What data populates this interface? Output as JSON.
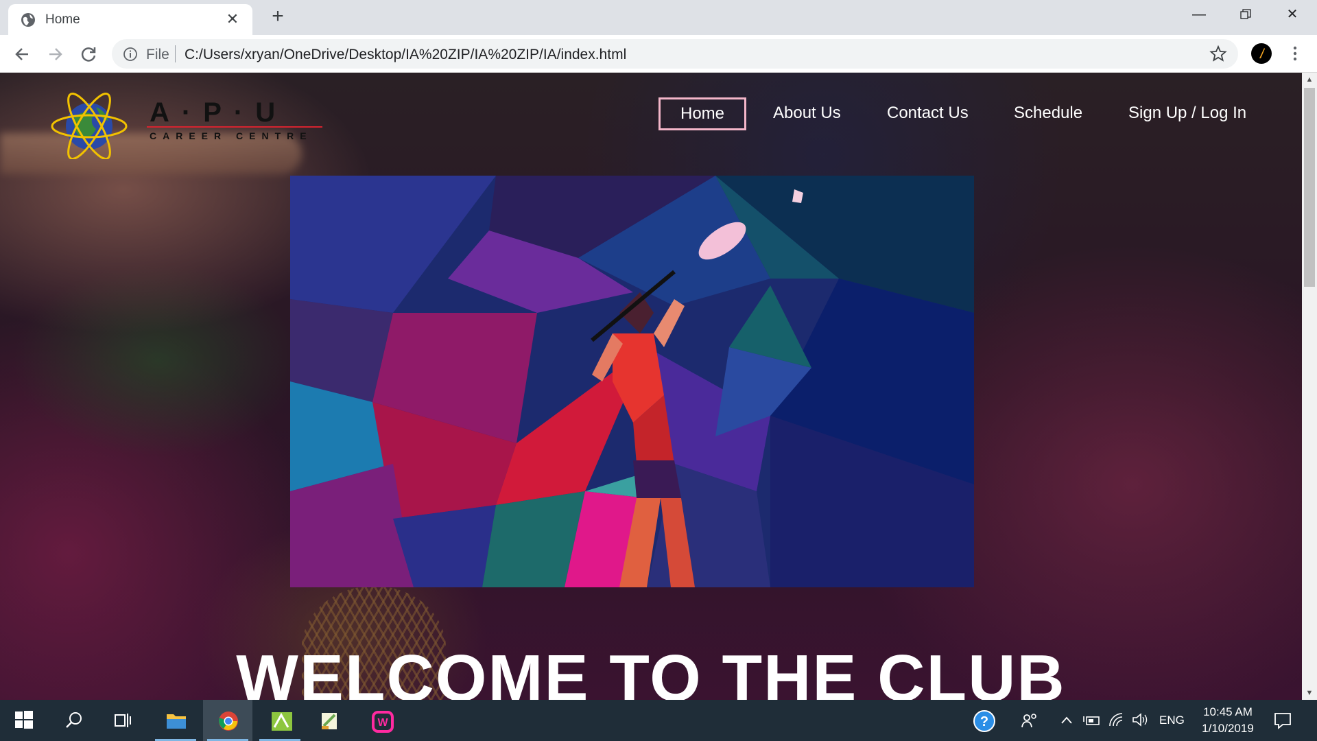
{
  "browser": {
    "tab": {
      "title": "Home",
      "favicon": "globe-icon"
    },
    "address": {
      "scheme": "File",
      "url": "C:/Users/xryan/OneDrive/Desktop/IA%20ZIP/IA%20ZIP/IA/index.html"
    },
    "icons": [
      "back-arrow-icon",
      "forward-arrow-icon",
      "reload-icon",
      "info-icon",
      "star-icon",
      "menu-dots-icon"
    ]
  },
  "site": {
    "logo": {
      "letters": "A·P·U",
      "subtitle": "CAREER CENTRE"
    },
    "nav": [
      {
        "label": "Home",
        "active": true
      },
      {
        "label": "About Us"
      },
      {
        "label": "Contact Us"
      },
      {
        "label": "Schedule"
      },
      {
        "label": "Sign Up / Log In"
      }
    ],
    "headline": "WELCOME TO THE CLUB",
    "colors": {
      "nav_active_border": "#f4b6c9",
      "text": "#ffffff"
    }
  },
  "taskbar": {
    "apps": [
      "windows-start-icon",
      "search-icon",
      "task-view-icon",
      "file-explorer-icon",
      "chrome-icon",
      "notepad-plus-icon",
      "app-icon",
      "wamp-icon"
    ],
    "tray": {
      "language": "ENG"
    },
    "clock": {
      "time": "10:45 AM",
      "date": "1/10/2019"
    }
  }
}
